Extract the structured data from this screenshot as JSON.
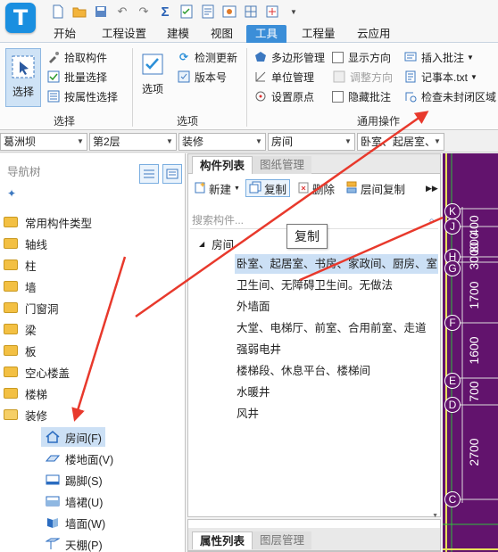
{
  "app": {
    "logo_letter": "T"
  },
  "tabs": [
    {
      "label": "开始"
    },
    {
      "label": "工程设置"
    },
    {
      "label": "建模"
    },
    {
      "label": "视图"
    },
    {
      "label": "工具"
    },
    {
      "label": "工程量"
    },
    {
      "label": "云应用"
    }
  ],
  "ribbon": {
    "select_group": {
      "label": "选择",
      "big_button": "选择",
      "items": [
        "拾取构件",
        "批量选择",
        "按属性选择"
      ]
    },
    "options_group": {
      "label": "选项",
      "big_button": "选项",
      "items": [
        "检测更新",
        "版本号"
      ]
    },
    "general_group": {
      "label": "通用操作",
      "items": [
        "多边形管理",
        "单位管理",
        "设置原点",
        "显示方向",
        "调整方向",
        "隐藏批注",
        "插入批注",
        "记事本.txt",
        "检查未封闭区域"
      ]
    }
  },
  "filters": [
    {
      "value": "葛洲坝"
    },
    {
      "value": "第2层"
    },
    {
      "value": "装修"
    },
    {
      "value": "房间"
    },
    {
      "value": "卧室、起居室、"
    }
  ],
  "nav": {
    "title": "导航树",
    "folders": [
      "常用构件类型",
      "轴线",
      "柱",
      "墙",
      "门窗洞",
      "梁",
      "板",
      "空心楼盖",
      "楼梯",
      "装修"
    ],
    "children": [
      "房间(F)",
      "楼地面(V)",
      "踢脚(S)",
      "墙裙(U)",
      "墙面(W)",
      "天棚(P)"
    ]
  },
  "component_list": {
    "tabs": [
      "构件列表",
      "图纸管理"
    ],
    "toolbar": {
      "new": "新建",
      "copy": "复制",
      "delete": "删除",
      "floor_copy": "层间复制"
    },
    "search_placeholder": "搜索构件...",
    "group": "房间",
    "items": [
      "卧室、起居室、书房、家政间、厨房、室内",
      "卫生间、无障碍卫生间。无做法",
      "外墙面",
      "大堂、电梯厅、前室、合用前室、走道",
      "强弱电井",
      "楼梯段、休息平台、楼梯间",
      "水暖井",
      "风井"
    ],
    "tooltip": "复制"
  },
  "property_list": {
    "tabs": [
      "属性列表",
      "图层管理"
    ]
  },
  "drawing": {
    "grid_labels": [
      "K",
      "J",
      "H",
      "G",
      "F",
      "E",
      "D",
      "C"
    ],
    "dimensions": [
      "400",
      "800",
      "3000",
      "1700",
      "1600",
      "700",
      "2700"
    ]
  },
  "colors": {
    "accent": "#3b8ed8",
    "canvas": "#62136d",
    "arrow": "#e8392c"
  }
}
